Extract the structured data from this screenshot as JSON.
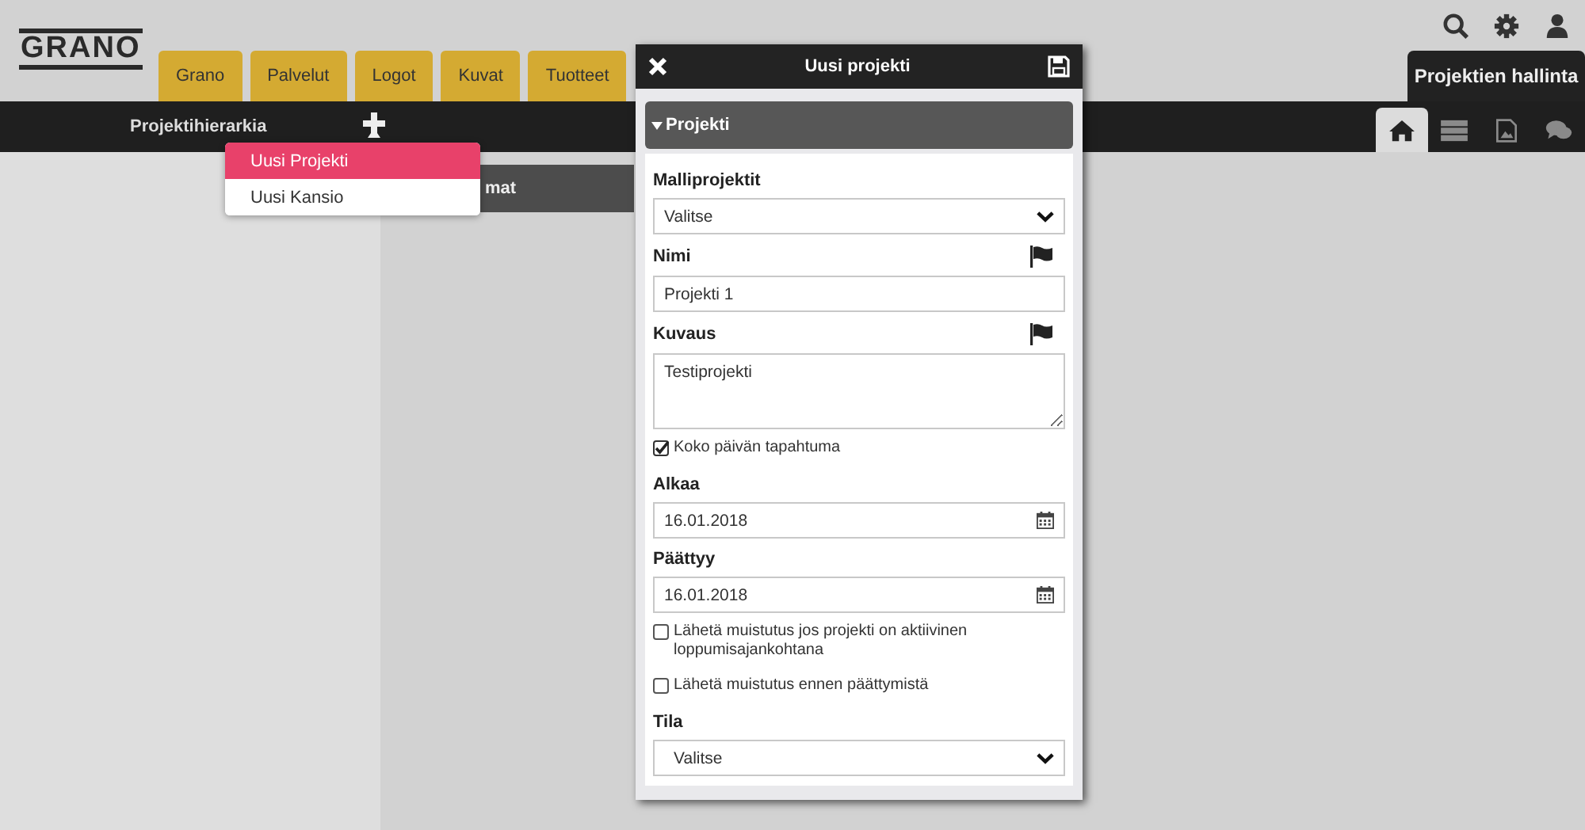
{
  "logo": "GRANO",
  "tabs": [
    {
      "label": "Grano"
    },
    {
      "label": "Palvelut"
    },
    {
      "label": "Logot"
    },
    {
      "label": "Kuvat"
    },
    {
      "label": "Tuotteet"
    }
  ],
  "header_icons": [
    {
      "kind": "search"
    },
    {
      "kind": "settings"
    },
    {
      "kind": "user"
    }
  ],
  "nav_bar": {
    "title": "Projektihierarkia"
  },
  "add_menu": {
    "items": [
      {
        "label": "Uusi Projekti",
        "selected": true
      },
      {
        "label": "Uusi Kansio",
        "selected": false
      }
    ]
  },
  "panel_header": {
    "title": "mat"
  },
  "admin_tab": {
    "label": "Projektien hallinta"
  },
  "view_tabs": [
    {
      "kind": "home",
      "selected": true
    },
    {
      "kind": "list",
      "selected": false
    },
    {
      "kind": "image",
      "selected": false
    },
    {
      "kind": "chat",
      "selected": false
    }
  ],
  "dialog": {
    "title": "Uusi projekti",
    "section": {
      "title": "Projekti",
      "expanded": true
    },
    "fields": [
      {
        "kind": "select",
        "label": "Malliprojektit",
        "value": "Valitse"
      },
      {
        "kind": "text",
        "label": "Nimi",
        "value": "Projekti 1",
        "flag": true
      },
      {
        "kind": "textarea",
        "label": "Kuvaus",
        "value": "Testiprojekti",
        "flag": true
      },
      {
        "kind": "checkbox",
        "label": "Koko päivän tapahtuma",
        "checked": true
      },
      {
        "kind": "date",
        "label": "Alkaa",
        "value": "16.01.2018"
      },
      {
        "kind": "date",
        "label": "Päättyy",
        "value": "16.01.2018"
      },
      {
        "kind": "checkbox",
        "label": "Lähetä muistutus jos projekti on aktiivinen loppumisajankohtana",
        "checked": false
      },
      {
        "kind": "checkbox",
        "label": "Lähetä muistutus ennen päättymistä",
        "checked": false
      },
      {
        "kind": "select",
        "label": "Tila",
        "value": "Valitse"
      }
    ]
  }
}
